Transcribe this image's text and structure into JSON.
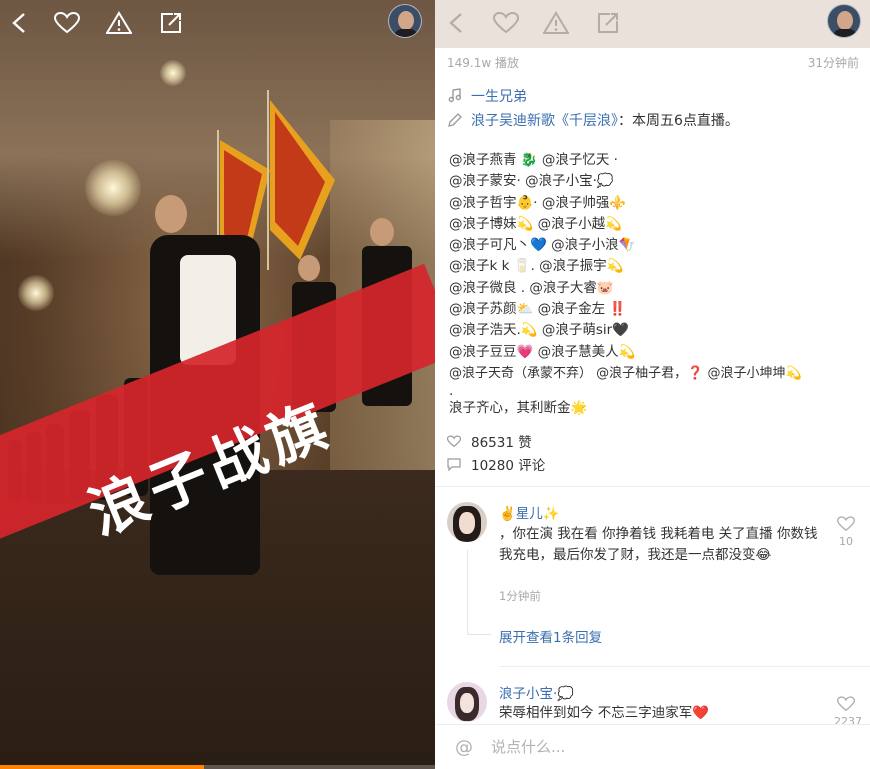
{
  "video": {
    "banner_text": "浪子战旗",
    "progress": 0.47,
    "icons": [
      "back-icon",
      "heart-icon",
      "warning-icon",
      "share-edit-icon"
    ]
  },
  "detail": {
    "play_count": "149.1w 播放",
    "time_ago": "31分钟前",
    "music_title": "一生兄弟",
    "promo_link": "浪子吴迪新歌《千层浪》",
    "promo_rest": "：本周五6点直播。",
    "mention_lines": [
      "@浪子燕青 🐉 @浪子忆天 ·",
      "@浪子蒙安· @浪子小宝·💭",
      " @浪子哲宇👶· @浪子帅强⚜️",
      "@浪子博妹💫 @浪子小越💫",
      "@浪子可凡丶💙 @浪子小浪🪁",
      "@浪子k k 🥛. @浪子振宇💫",
      "@浪子微良 . @浪子大睿🐷",
      "@浪子苏颜⛅ @浪子金左 ‼️",
      "@浪子浩天.💫 @浪子萌sir🖤",
      "@浪子豆豆💗 @浪子慧美人💫",
      "@浪子天奇（承蒙不弃） @浪子柚子君，❓ @浪子小坤坤💫",
      ".",
      "浪子齐心，其利断金🌟"
    ],
    "likes": "86531 赞",
    "comments": "10280 评论",
    "comment1": {
      "name": "✌️星儿✨",
      "text": "，你在演 我在看 你挣着钱 我耗着电 关了直播 你数钱 我充电，最后你发了财，我还是一点都没变😂",
      "time": "1分钟前",
      "like_count": "10",
      "reply_link": "展开查看1条回复"
    },
    "comment2": {
      "name": "浪子小宝·💭",
      "text": "荣辱相伴到如今 不忘三字迪家军❤️",
      "like_count": "2237"
    },
    "input_placeholder": "说点什么..."
  },
  "colors": {
    "link_blue": "#3b6fb0",
    "banner_red": "#d5262b",
    "progress_orange": "#ff8200",
    "muted_gray": "#a8a8a8"
  }
}
